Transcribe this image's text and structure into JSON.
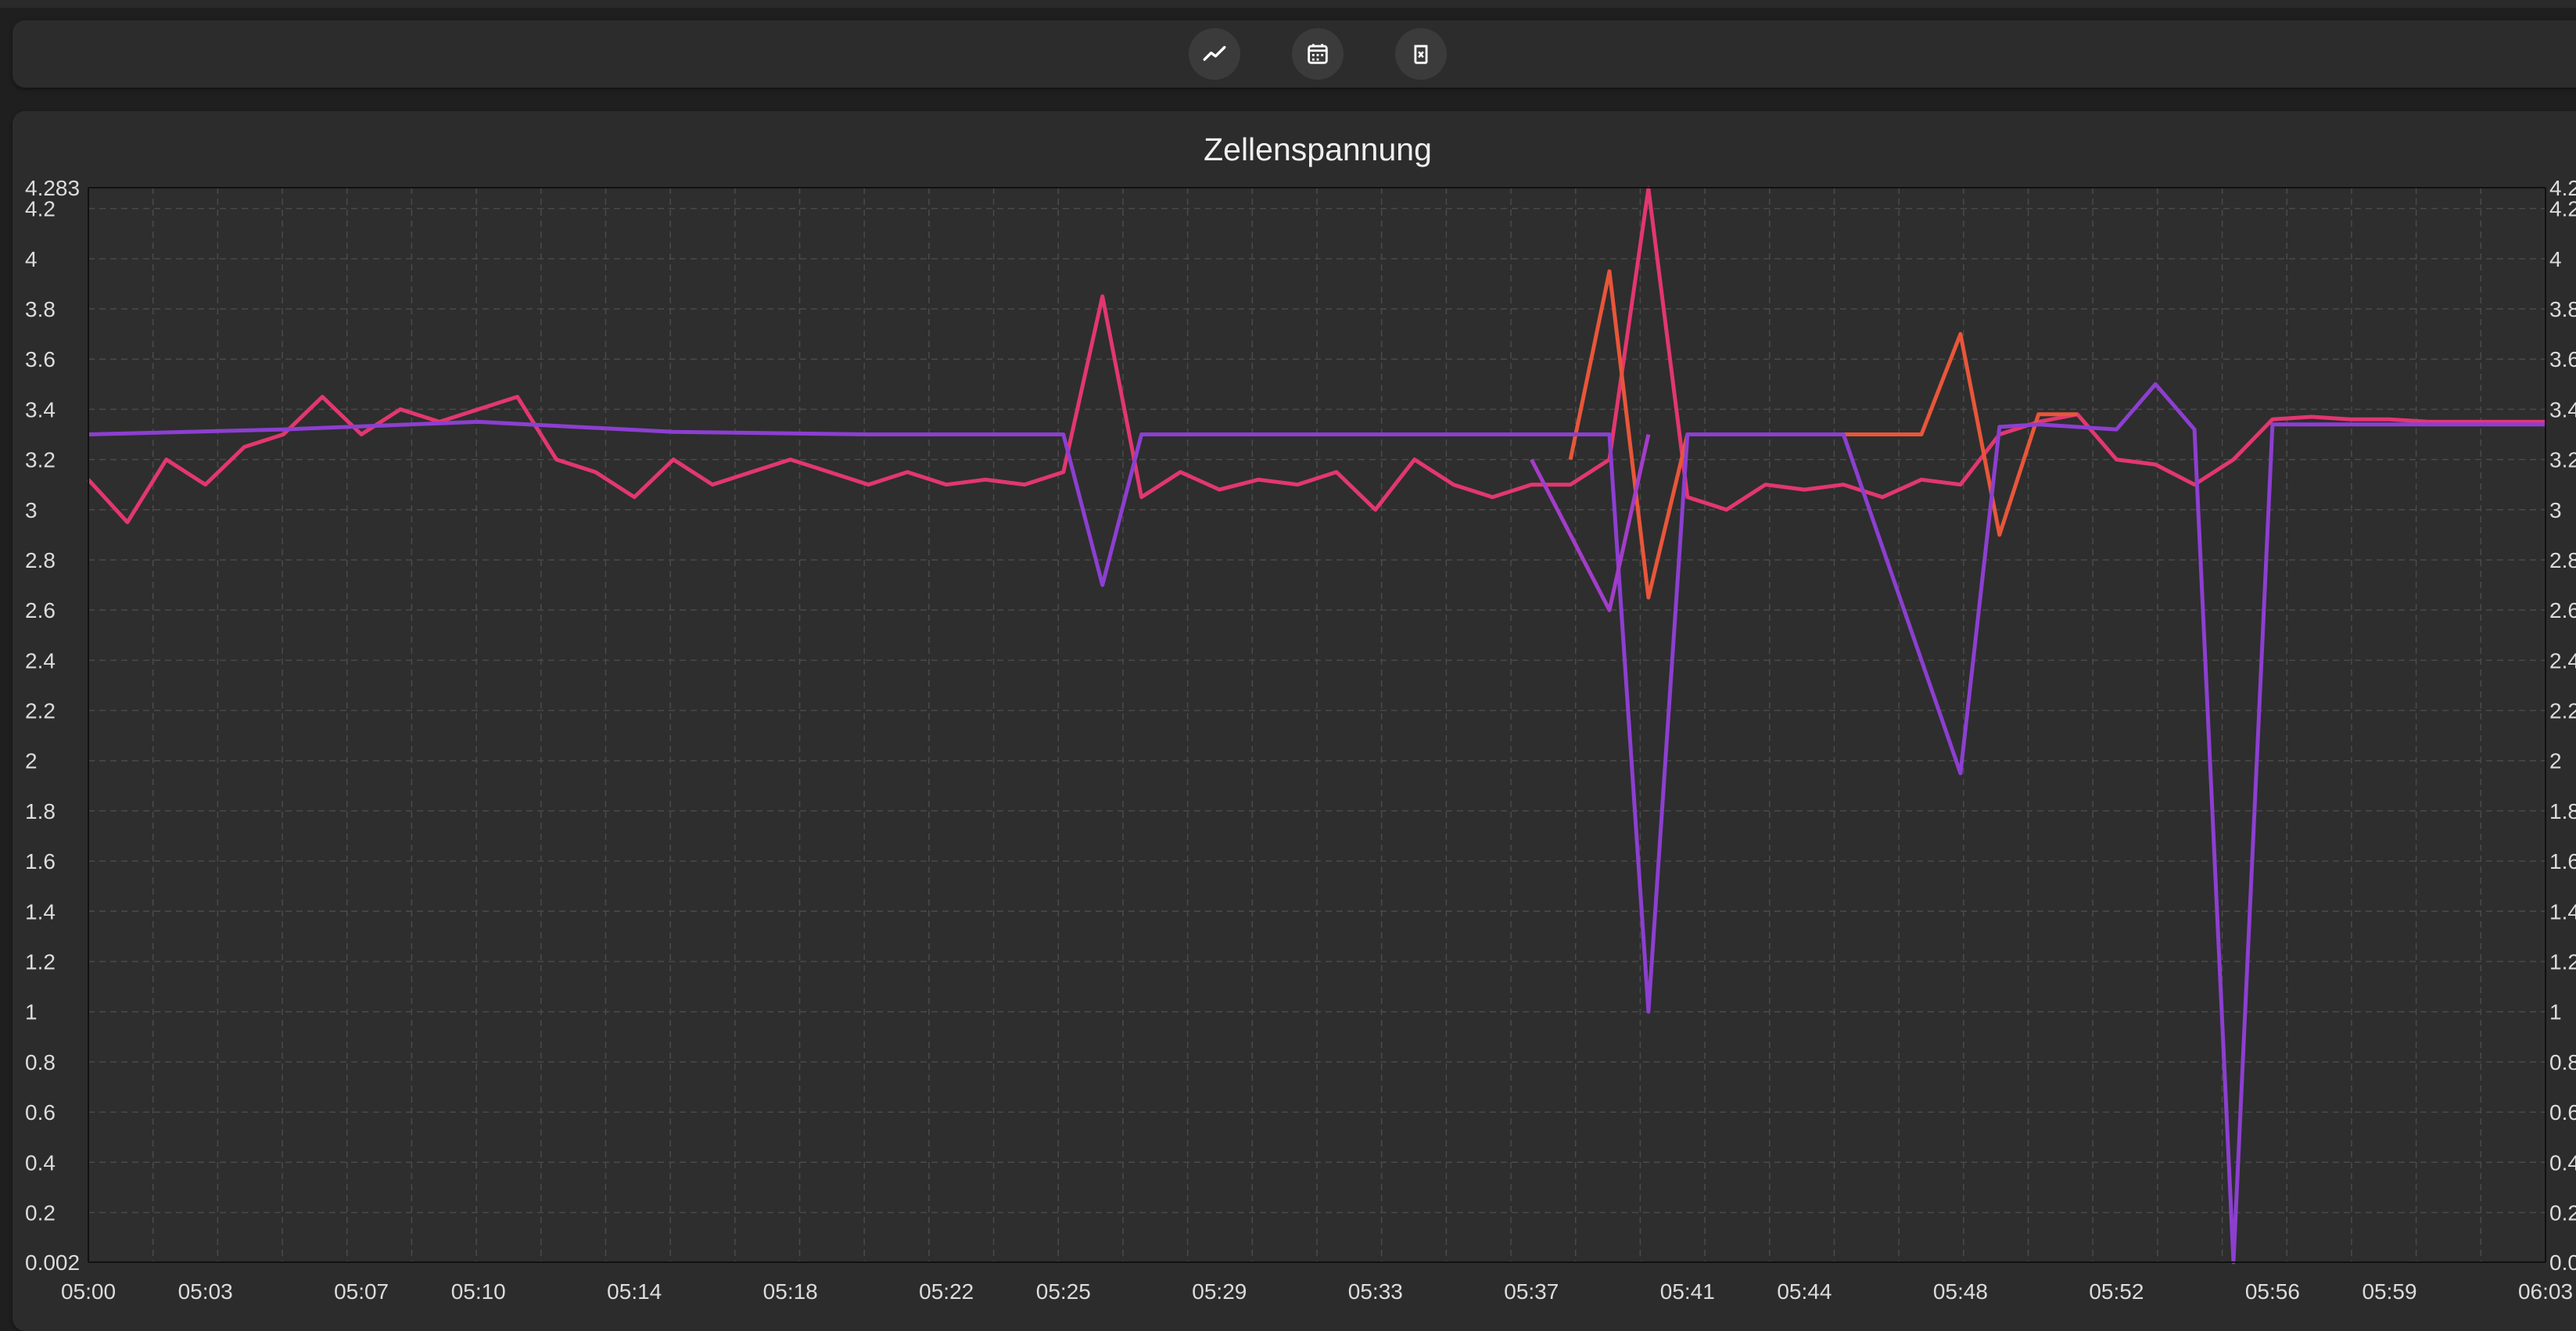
{
  "toolbar": {
    "buttons": [
      {
        "name": "chart-line-icon"
      },
      {
        "name": "calendar-icon"
      },
      {
        "name": "delete-icon"
      }
    ]
  },
  "colors": {
    "background": "#1f1f1f",
    "panel": "#2c2c2c",
    "grid": "#4a4a4a",
    "series_pink": "#e2376f",
    "series_orange": "#e8563a",
    "series_purple": "#8c3fd0",
    "series_violet": "#a33dc8"
  },
  "chart_data": {
    "type": "line",
    "title": "Zellenspannung",
    "xlabel": "",
    "ylabel": "",
    "grid": true,
    "legend": "none",
    "x_ticks": [
      "05:00",
      "05:03",
      "05:07",
      "05:10",
      "05:14",
      "05:18",
      "05:22",
      "05:25",
      "05:29",
      "05:33",
      "05:37",
      "05:41",
      "05:44",
      "05:48",
      "05:52",
      "05:56",
      "05:59",
      "06:03"
    ],
    "y_ticks": [
      "0.002",
      "0.2",
      "0.4",
      "0.6",
      "0.8",
      "1",
      "1.2",
      "1.4",
      "1.6",
      "1.8",
      "2",
      "2.2",
      "2.4",
      "2.6",
      "2.8",
      "3",
      "3.2",
      "3.4",
      "3.6",
      "3.8",
      "4",
      "4.2",
      "4.283"
    ],
    "ylim": [
      0.002,
      4.283
    ],
    "xlim": [
      "05:00",
      "06:03"
    ],
    "series": [
      {
        "color": "#e2376f",
        "x": [
          "05:00",
          "05:01",
          "05:02",
          "05:03",
          "05:04",
          "05:05",
          "05:06",
          "05:07",
          "05:08",
          "05:09",
          "05:10",
          "05:11",
          "05:12",
          "05:13",
          "05:14",
          "05:15",
          "05:16",
          "05:17",
          "05:18",
          "05:19",
          "05:20",
          "05:21",
          "05:22",
          "05:23",
          "05:24",
          "05:25",
          "05:26",
          "05:27",
          "05:28",
          "05:29",
          "05:30",
          "05:31",
          "05:32",
          "05:33",
          "05:34",
          "05:35",
          "05:36",
          "05:37",
          "05:38",
          "05:39",
          "05:40",
          "05:41",
          "05:42",
          "05:43",
          "05:44",
          "05:45",
          "05:46",
          "05:47",
          "05:48",
          "05:49",
          "05:50",
          "05:51",
          "05:52",
          "05:53",
          "05:54",
          "05:55",
          "05:56",
          "05:57",
          "05:58",
          "05:59",
          "06:00",
          "06:01",
          "06:02",
          "06:03"
        ],
        "y": [
          3.12,
          2.95,
          3.2,
          3.1,
          3.25,
          3.3,
          3.45,
          3.3,
          3.4,
          3.35,
          3.4,
          3.45,
          3.2,
          3.15,
          3.05,
          3.2,
          3.1,
          3.15,
          3.2,
          3.15,
          3.1,
          3.15,
          3.1,
          3.12,
          3.1,
          3.15,
          3.85,
          3.05,
          3.15,
          3.08,
          3.12,
          3.1,
          3.15,
          3.0,
          3.2,
          3.1,
          3.05,
          3.1,
          3.1,
          3.2,
          4.28,
          3.05,
          3.0,
          3.1,
          3.08,
          3.1,
          3.05,
          3.12,
          3.1,
          3.3,
          3.35,
          3.38,
          3.2,
          3.18,
          3.1,
          3.2,
          3.36,
          3.37,
          3.36,
          3.36,
          3.35,
          3.35,
          3.35,
          3.35
        ]
      },
      {
        "color": "#e8563a",
        "x": [
          "05:38",
          "05:39",
          "05:40",
          "05:41",
          "05:47",
          "05:48",
          "05:49",
          "05:50",
          "05:51"
        ],
        "y": [
          3.2,
          3.95,
          2.65,
          3.3,
          3.3,
          3.7,
          2.9,
          3.38,
          3.38
        ]
      },
      {
        "color": "#8c3fd0",
        "x": [
          "05:00",
          "05:05",
          "05:10",
          "05:15",
          "05:20",
          "05:25",
          "05:26",
          "05:27",
          "05:30",
          "05:35",
          "05:38",
          "05:39",
          "05:40",
          "05:41",
          "05:45",
          "05:48",
          "05:49",
          "05:50",
          "05:52",
          "05:53",
          "05:54",
          "05:55",
          "05:56",
          "06:00",
          "06:03"
        ],
        "y": [
          3.3,
          3.32,
          3.35,
          3.31,
          3.3,
          3.3,
          2.7,
          3.3,
          3.3,
          3.3,
          3.3,
          3.3,
          1.0,
          3.3,
          3.3,
          1.95,
          3.33,
          3.34,
          3.32,
          3.5,
          3.32,
          0.002,
          3.34,
          3.34,
          3.34
        ]
      },
      {
        "color": "#a33dc8",
        "x": [
          "05:37",
          "05:38",
          "05:39",
          "05:40"
        ],
        "y": [
          3.2,
          2.9,
          2.6,
          3.3
        ]
      }
    ]
  }
}
